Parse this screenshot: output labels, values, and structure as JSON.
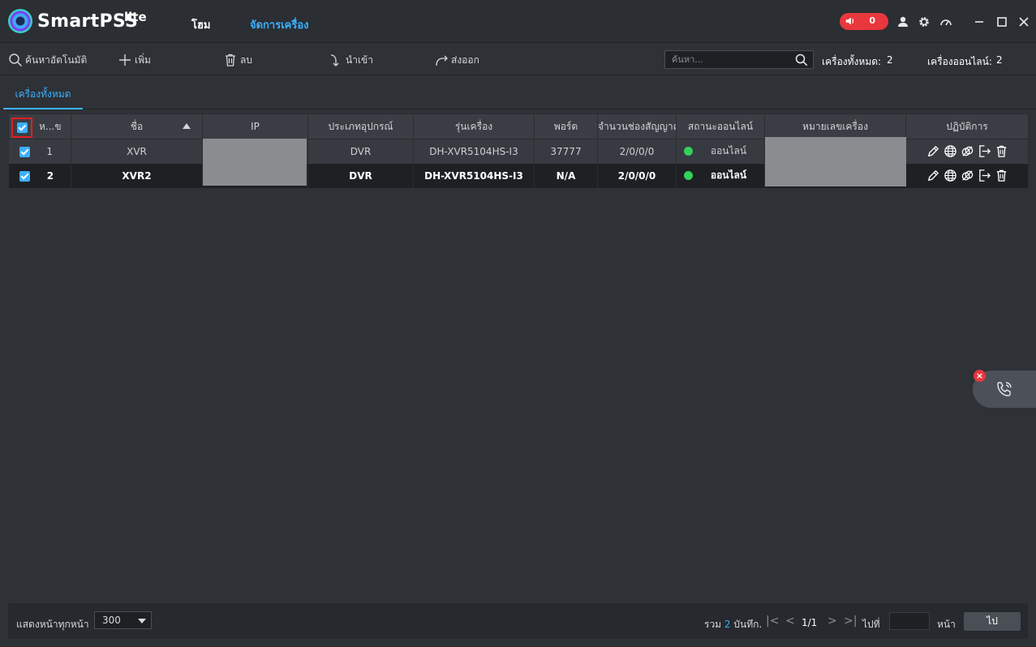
{
  "app": {
    "brand": "SmartPSS",
    "brand_sup": "lite",
    "nav_home": "โฮม",
    "nav_device_manager": "จัดการเครื่อง",
    "alarm_count": "0"
  },
  "toolbar": {
    "auto_search": "ค้นหาอัตโนมัติ",
    "add": "เพิ่ม",
    "delete": "ลบ",
    "import": "นำเข้า",
    "export": "ส่งออก",
    "search_placeholder": "ค้นหา...",
    "total_label": "เครื่องทั้งหมด:",
    "total_value": "2",
    "online_label": "เครื่องออนไลน์:",
    "online_value": "2"
  },
  "tabs": {
    "all_devices": "เครื่องทั้งหมด"
  },
  "table": {
    "headers": {
      "no": "ห...ข",
      "name": "ชื่อ",
      "ip": "IP",
      "type": "ประเภทอุปกรณ์",
      "model": "รุ่นเครื่อง",
      "port": "พอร์ต",
      "channels": "จำนวนช่องสัญญาณ",
      "status": "สถานะออนไลน์",
      "serial": "หมายเลขเครื่อง",
      "actions": "ปฏิบัติการ"
    },
    "rows": [
      {
        "no": "1",
        "name": "XVR",
        "type": "DVR",
        "model": "DH-XVR5104HS-I3",
        "port": "37777",
        "channels": "2/0/0/0",
        "status": "ออนไลน์"
      },
      {
        "no": "2",
        "name": "XVR2",
        "type": "DVR",
        "model": "DH-XVR5104HS-I3",
        "port": "N/A",
        "channels": "2/0/0/0",
        "status": "ออนไลน์"
      }
    ],
    "status_color": "#34d058"
  },
  "footer": {
    "per_page_label": "แสดงหน้าทุกหน้า",
    "per_page_value": "300",
    "total_prefix": "รวม",
    "total_count": "2",
    "total_suffix": "บันทึก.",
    "page_info": "1/1",
    "goto_label": "ไปที่",
    "page_label": "หน้า",
    "go_button": "ไป"
  }
}
